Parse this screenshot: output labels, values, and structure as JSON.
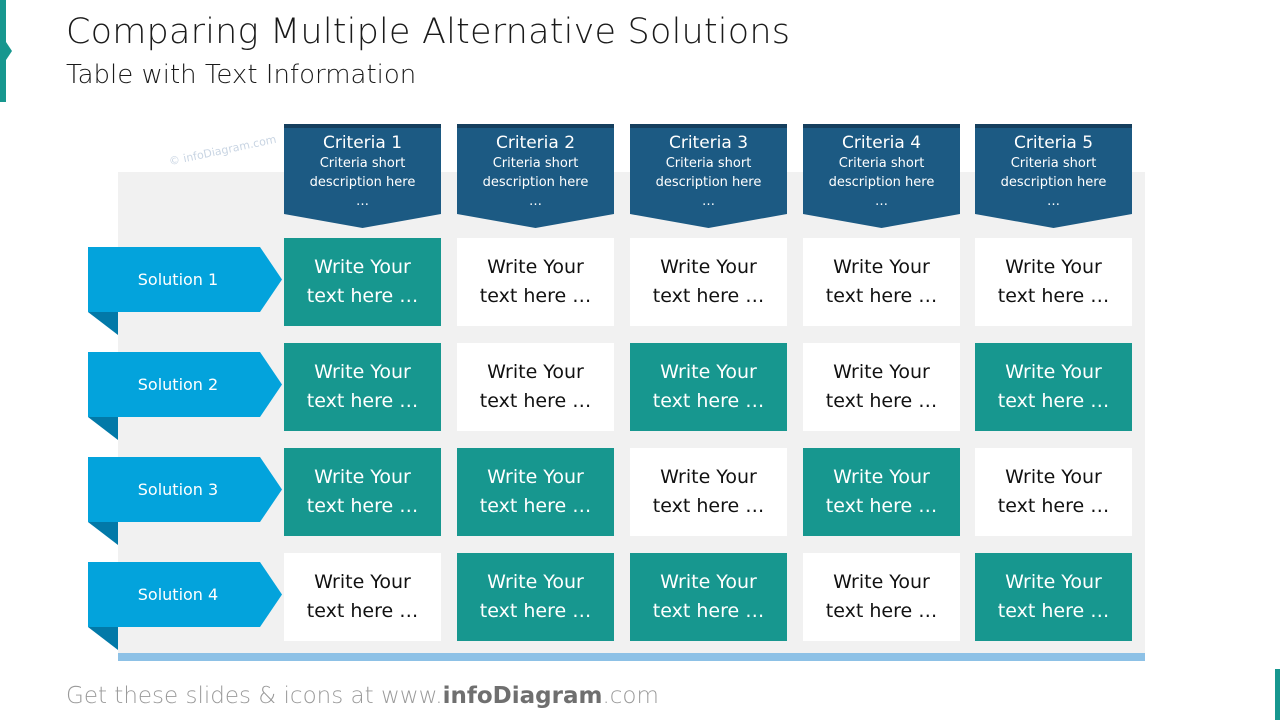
{
  "title": "Comparing Multiple Alternative Solutions",
  "subtitle": "Table with Text Information",
  "watermark": "© infoDiagram.com",
  "colors": {
    "header_dark": "#1c5a83",
    "header_top": "#153f5e",
    "solution_blue": "#03a3dc",
    "solution_fold": "#0279a8",
    "teal": "#17978f",
    "panel_grey": "#f1f1f1",
    "bottom_bar": "#8dc1e6"
  },
  "criteria": [
    {
      "title": "Criteria 1",
      "desc1": "Criteria short",
      "desc2": "description here",
      "desc3": "…"
    },
    {
      "title": "Criteria 2",
      "desc1": "Criteria short",
      "desc2": "description here",
      "desc3": "…"
    },
    {
      "title": "Criteria 3",
      "desc1": "Criteria short",
      "desc2": "description here",
      "desc3": "…"
    },
    {
      "title": "Criteria 4",
      "desc1": "Criteria short",
      "desc2": "description here",
      "desc3": "…"
    },
    {
      "title": "Criteria 5",
      "desc1": "Criteria short",
      "desc2": "description here",
      "desc3": "…"
    }
  ],
  "solutions": [
    {
      "label": "Solution 1",
      "cells": [
        {
          "line1": "Write Your",
          "line2": "text here …",
          "style": "teal"
        },
        {
          "line1": "Write Your",
          "line2": "text here …",
          "style": "white"
        },
        {
          "line1": "Write Your",
          "line2": "text here …",
          "style": "white"
        },
        {
          "line1": "Write Your",
          "line2": "text here …",
          "style": "white"
        },
        {
          "line1": "Write Your",
          "line2": "text here …",
          "style": "white"
        }
      ]
    },
    {
      "label": "Solution 2",
      "cells": [
        {
          "line1": "Write Your",
          "line2": "text here …",
          "style": "teal"
        },
        {
          "line1": "Write Your",
          "line2": "text here …",
          "style": "white"
        },
        {
          "line1": "Write Your",
          "line2": "text here …",
          "style": "teal"
        },
        {
          "line1": "Write Your",
          "line2": "text here …",
          "style": "white"
        },
        {
          "line1": "Write Your",
          "line2": "text here …",
          "style": "teal"
        }
      ]
    },
    {
      "label": "Solution 3",
      "cells": [
        {
          "line1": "Write Your",
          "line2": "text here …",
          "style": "teal"
        },
        {
          "line1": "Write Your",
          "line2": "text here …",
          "style": "teal"
        },
        {
          "line1": "Write Your",
          "line2": "text here …",
          "style": "white"
        },
        {
          "line1": "Write Your",
          "line2": "text here …",
          "style": "teal"
        },
        {
          "line1": "Write Your",
          "line2": "text here …",
          "style": "white"
        }
      ]
    },
    {
      "label": "Solution 4",
      "cells": [
        {
          "line1": "Write Your",
          "line2": "text here …",
          "style": "white"
        },
        {
          "line1": "Write Your",
          "line2": "text here …",
          "style": "teal"
        },
        {
          "line1": "Write Your",
          "line2": "text here …",
          "style": "teal"
        },
        {
          "line1": "Write Your",
          "line2": "text here …",
          "style": "white"
        },
        {
          "line1": "Write Your",
          "line2": "text here …",
          "style": "teal"
        }
      ]
    }
  ],
  "footer": {
    "prefix": "Get these slides & icons at www.",
    "brand": "infoDiagram",
    "suffix": ".com"
  }
}
